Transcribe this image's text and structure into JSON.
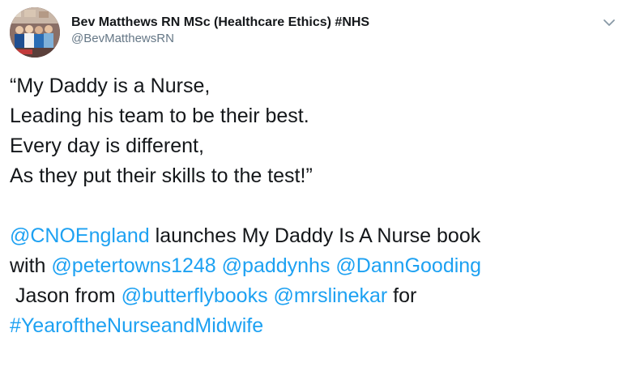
{
  "tweet": {
    "display_name": "Bev Matthews RN MSc (Healthcare Ethics) #NHS",
    "handle": "@BevMatthewsRN",
    "avatar_icon": "profile-photo",
    "menu_icon": "chevron-down-icon",
    "quote_lines": [
      "“My Daddy is a Nurse,",
      "Leading his team to be their best.",
      "Every day is different,",
      "As they put their skills to the test!”"
    ],
    "line5": {
      "mention_cno": "@CNOEngland",
      "text_a": " launches My Daddy Is A Nurse book"
    },
    "line6": {
      "text_with": "with ",
      "mention_petertowns": "@petertowns1248",
      "space_1": " ",
      "mention_paddynhs": "@paddynhs",
      "space_2": " ",
      "mention_danngooding": "@DannGooding"
    },
    "line7": {
      "text_jason": " Jason from ",
      "mention_butterflybooks": "@butterflybooks",
      "space_3": " ",
      "mention_mrslinekar": "@mrslinekar",
      "text_for": " for"
    },
    "line8": {
      "hashtag": "#YearoftheNurseandMidwife"
    },
    "colors": {
      "link": "#1da1f2",
      "text": "#14171a",
      "secondary": "#657786"
    }
  }
}
